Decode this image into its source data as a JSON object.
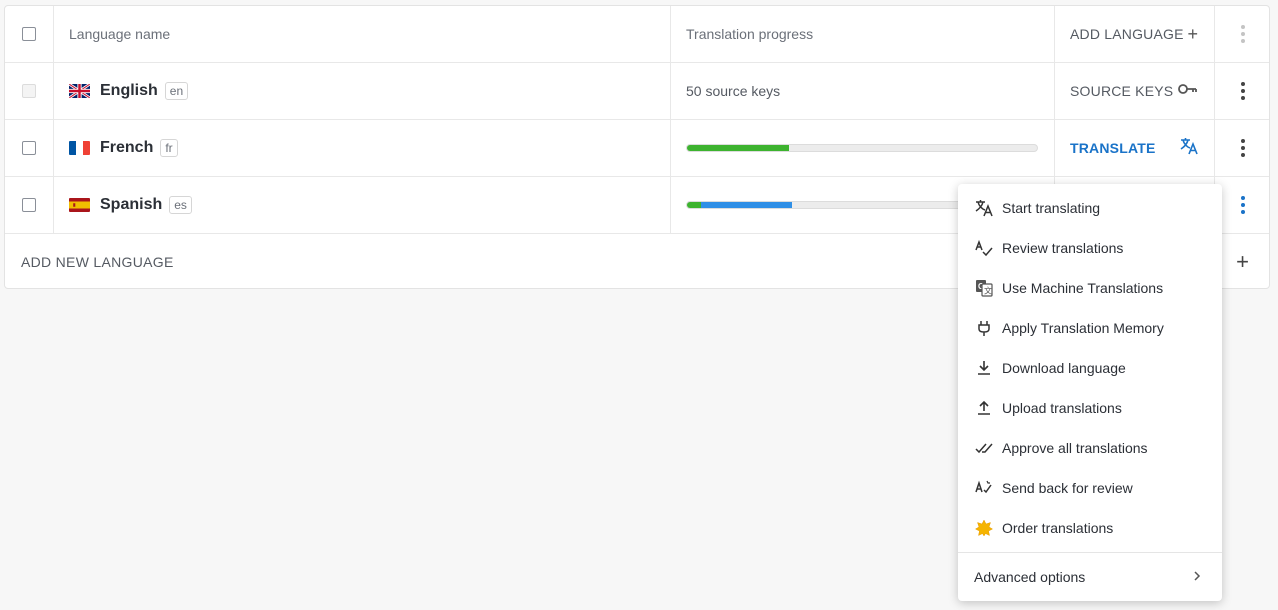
{
  "header": {
    "language_name": "Language name",
    "translation_progress": "Translation progress",
    "add_language": "ADD LANGUAGE"
  },
  "languages": [
    {
      "name": "English",
      "code": "en",
      "progress_text": "50 source keys",
      "action": "SOURCE KEYS",
      "action_icon": "key-icon"
    },
    {
      "name": "French",
      "code": "fr",
      "progress": {
        "green": 0.29,
        "blue": 0
      },
      "action": "TRANSLATE",
      "action_icon": "translate-icon"
    },
    {
      "name": "Spanish",
      "code": "es",
      "progress": {
        "green": 0.04,
        "blue": 0.26
      }
    }
  ],
  "footer": {
    "add_new_language": "ADD NEW LANGUAGE"
  },
  "menu": {
    "items": [
      {
        "label": "Start translating",
        "icon": "translate-icon"
      },
      {
        "label": "Review translations",
        "icon": "spellcheck-icon"
      },
      {
        "label": "Use Machine Translations",
        "icon": "google-translate-icon"
      },
      {
        "label": "Apply Translation Memory",
        "icon": "plug-icon"
      },
      {
        "label": "Download language",
        "icon": "download-icon"
      },
      {
        "label": "Upload translations",
        "icon": "upload-icon"
      },
      {
        "label": "Approve all translations",
        "icon": "double-check-icon"
      },
      {
        "label": "Send back for review",
        "icon": "text-review-icon"
      },
      {
        "label": "Order translations",
        "icon": "star-badge-icon"
      }
    ],
    "advanced": "Advanced options"
  },
  "colors": {
    "green": "#3db32f",
    "blue": "#2f8fe6",
    "accent": "#1a73c8"
  }
}
